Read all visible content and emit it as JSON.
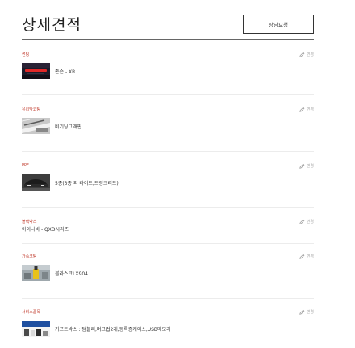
{
  "header": {
    "title": "상세견적",
    "consult_button": "상담요청"
  },
  "change_label": "변경",
  "sections": [
    {
      "label": "썬팅",
      "item": "존슨 - XR"
    },
    {
      "label": "유리막코팅",
      "item": "비기닝그래핀"
    },
    {
      "label": "PPF",
      "item": "5종(3종 외 라이트,트렁크리드)"
    },
    {
      "label": "블랙박스",
      "item": "아이나비 - QXD시리즈"
    },
    {
      "label": "가죽코팅",
      "item": "블라스크LX904"
    },
    {
      "label": "서비스품목",
      "item": "기프트박스 : 텀블러,머그컵2개,동록증케이스,USB메모리"
    }
  ],
  "colors": {
    "section_label": "#c0392b",
    "change_link": "#aaaaaa",
    "divider": "#ececec"
  }
}
